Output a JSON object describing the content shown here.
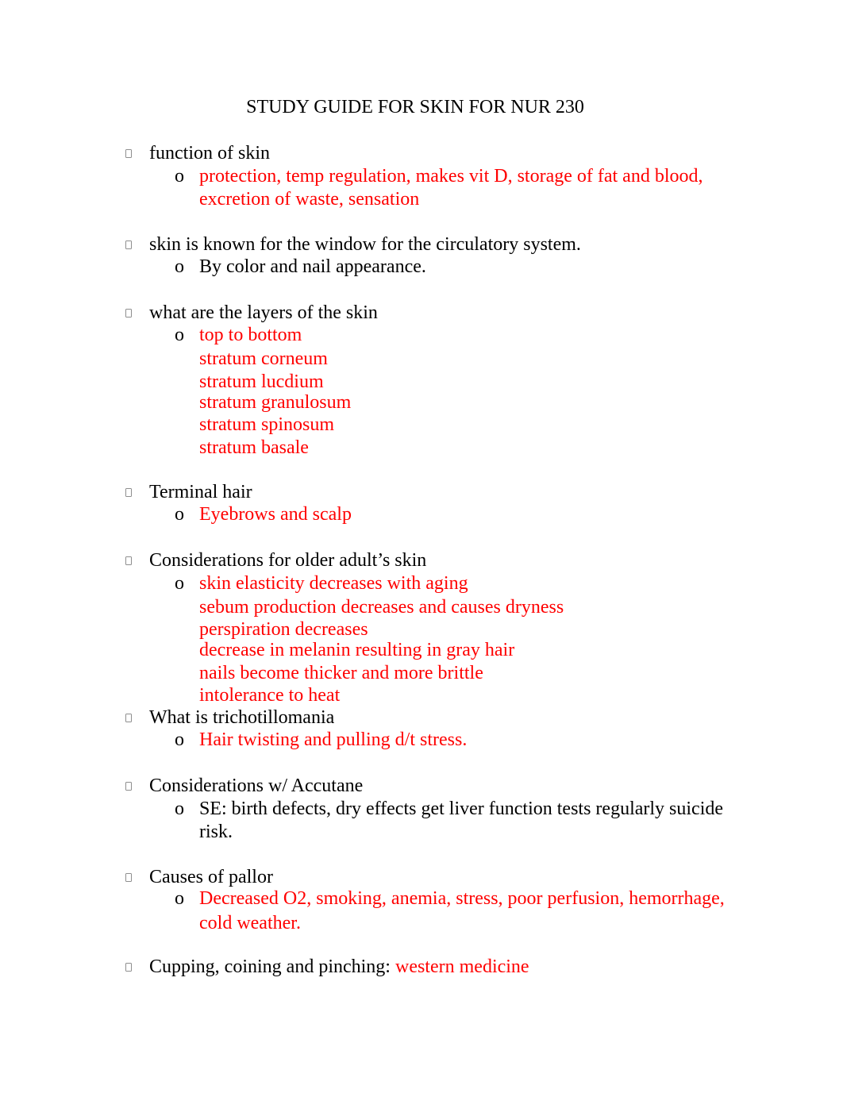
{
  "document": {
    "title": "STUDY GUIDE FOR SKIN FOR NUR 230",
    "bullet_glyph": "missing-glyph-box",
    "sub_bullet": "o",
    "colors": {
      "text": "#000000",
      "answer": "#ff0000"
    },
    "sections": [
      {
        "question": "function of skin",
        "answers": [
          {
            "text": "protection, temp regulation, makes vit D, storage of fat and blood,",
            "color": "red"
          },
          {
            "text": "excretion of waste, sensation",
            "color": "red"
          }
        ]
      },
      {
        "question": "skin is known for the window for the circulatory system.",
        "answers": [
          {
            "text": "By color and nail appearance.",
            "color": "black"
          }
        ]
      },
      {
        "question": "what are the layers of the skin",
        "answers": [
          {
            "text": "top to bottom",
            "color": "red"
          },
          {
            "text": "stratum corneum",
            "color": "red"
          },
          {
            "text": "stratum lucdium",
            "color": "red"
          },
          {
            "text": "stratum granulosum",
            "color": "red"
          },
          {
            "text": "stratum spinosum",
            "color": "red"
          },
          {
            "text": "stratum basale",
            "color": "red"
          }
        ]
      },
      {
        "question": "Terminal hair",
        "answers": [
          {
            "text": "Eyebrows and scalp",
            "color": "red"
          }
        ]
      },
      {
        "question": "Considerations for older adult’s skin",
        "answers": [
          {
            "text": "skin elasticity decreases with aging",
            "color": "red"
          },
          {
            "text": "sebum production decreases and causes dryness",
            "color": "red"
          },
          {
            "text": "perspiration decreases",
            "color": "red"
          },
          {
            "text": "decrease in melanin resulting in gray hair",
            "color": "red"
          },
          {
            "text": "nails become thicker and more brittle",
            "color": "red"
          },
          {
            "text": "intolerance to heat",
            "color": "red"
          }
        ]
      },
      {
        "question": "What is trichotillomania",
        "answers": [
          {
            "text": "Hair twisting and pulling d/t stress.",
            "color": "red"
          }
        ]
      },
      {
        "question": "Considerations w/ Accutane",
        "answers": [
          {
            "text": "SE: birth defects, dry effects get liver function tests regularly suicide",
            "color": "black"
          },
          {
            "text": "risk.",
            "color": "black"
          }
        ]
      },
      {
        "question": "Causes of pallor",
        "answers": [
          {
            "text": "Decreased O2, smoking, anemia, stress, poor perfusion, hemorrhage,",
            "color": "red"
          },
          {
            "text": "cold weather.",
            "color": "red"
          }
        ]
      },
      {
        "question": "Cupping, coining and pinching: ",
        "inline_answer": "western medicine"
      }
    ]
  }
}
